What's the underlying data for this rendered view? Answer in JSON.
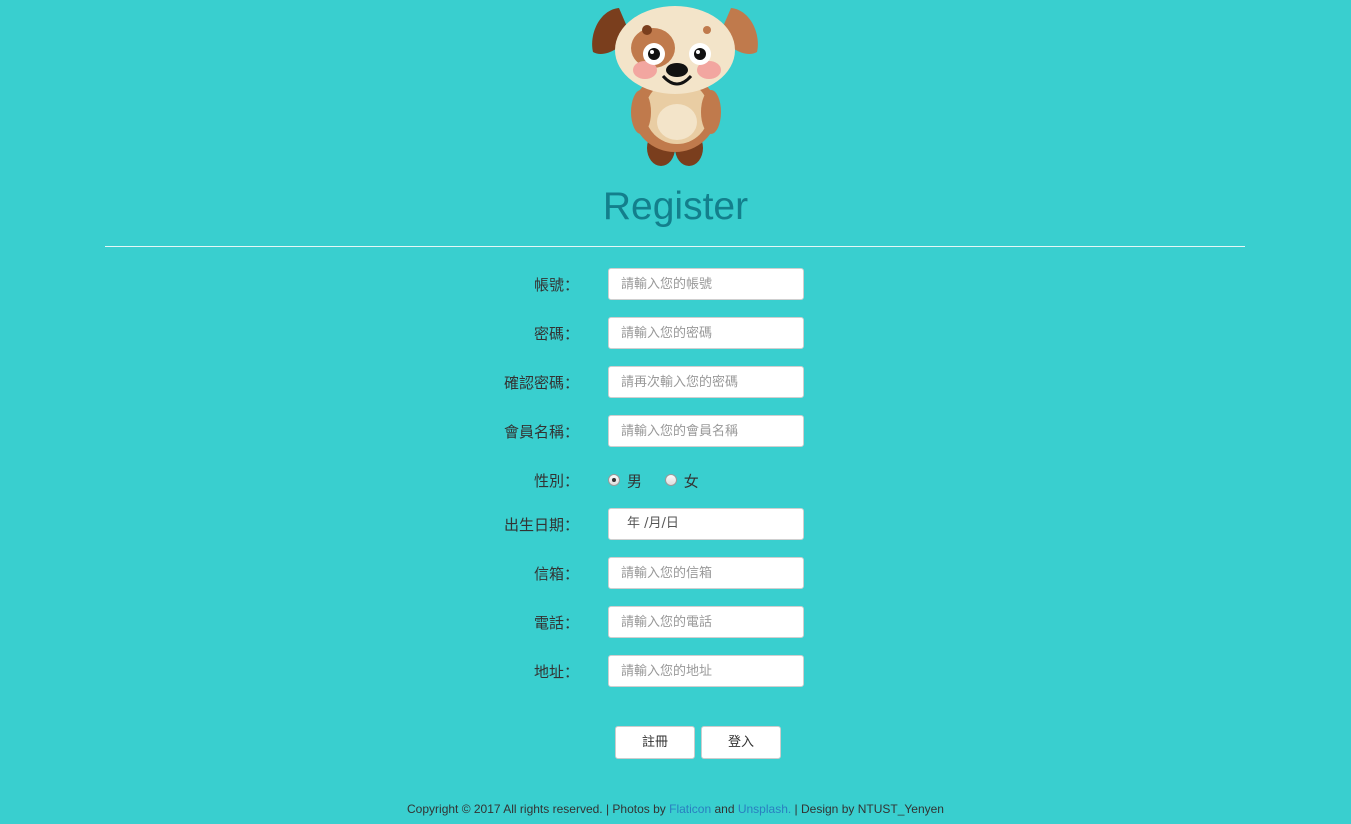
{
  "header": {
    "title": "Register"
  },
  "form": {
    "fields": [
      {
        "label": "帳號：",
        "placeholder": "請輸入您的帳號"
      },
      {
        "label": "密碼：",
        "placeholder": "請輸入您的密碼"
      },
      {
        "label": "確認密碼：",
        "placeholder": "請再次輸入您的密碼"
      },
      {
        "label": "會員名稱：",
        "placeholder": "請輸入您的會員名稱"
      }
    ],
    "gender": {
      "label": "性別：",
      "options": [
        {
          "label": "男",
          "checked": true
        },
        {
          "label": "女",
          "checked": false
        }
      ]
    },
    "birthday": {
      "label": "出生日期：",
      "value": "年 /月/日"
    },
    "contact_fields": [
      {
        "label": "信箱：",
        "placeholder": "請輸入您的信箱"
      },
      {
        "label": "電話：",
        "placeholder": "請輸入您的電話"
      },
      {
        "label": "地址：",
        "placeholder": "請輸入您的地址"
      }
    ]
  },
  "buttons": {
    "register": "註冊",
    "login": "登入"
  },
  "footer": {
    "copyright": "Copyright © 2017 All rights reserved. | Photos by ",
    "flaticon": "Flaticon",
    "and": " and ",
    "unsplash": "Unsplash.",
    "design": " | Design by NTUST_Yenyen"
  },
  "colors": {
    "background": "#39cfcf",
    "title": "#137f8c",
    "link": "#2a7fc0"
  }
}
